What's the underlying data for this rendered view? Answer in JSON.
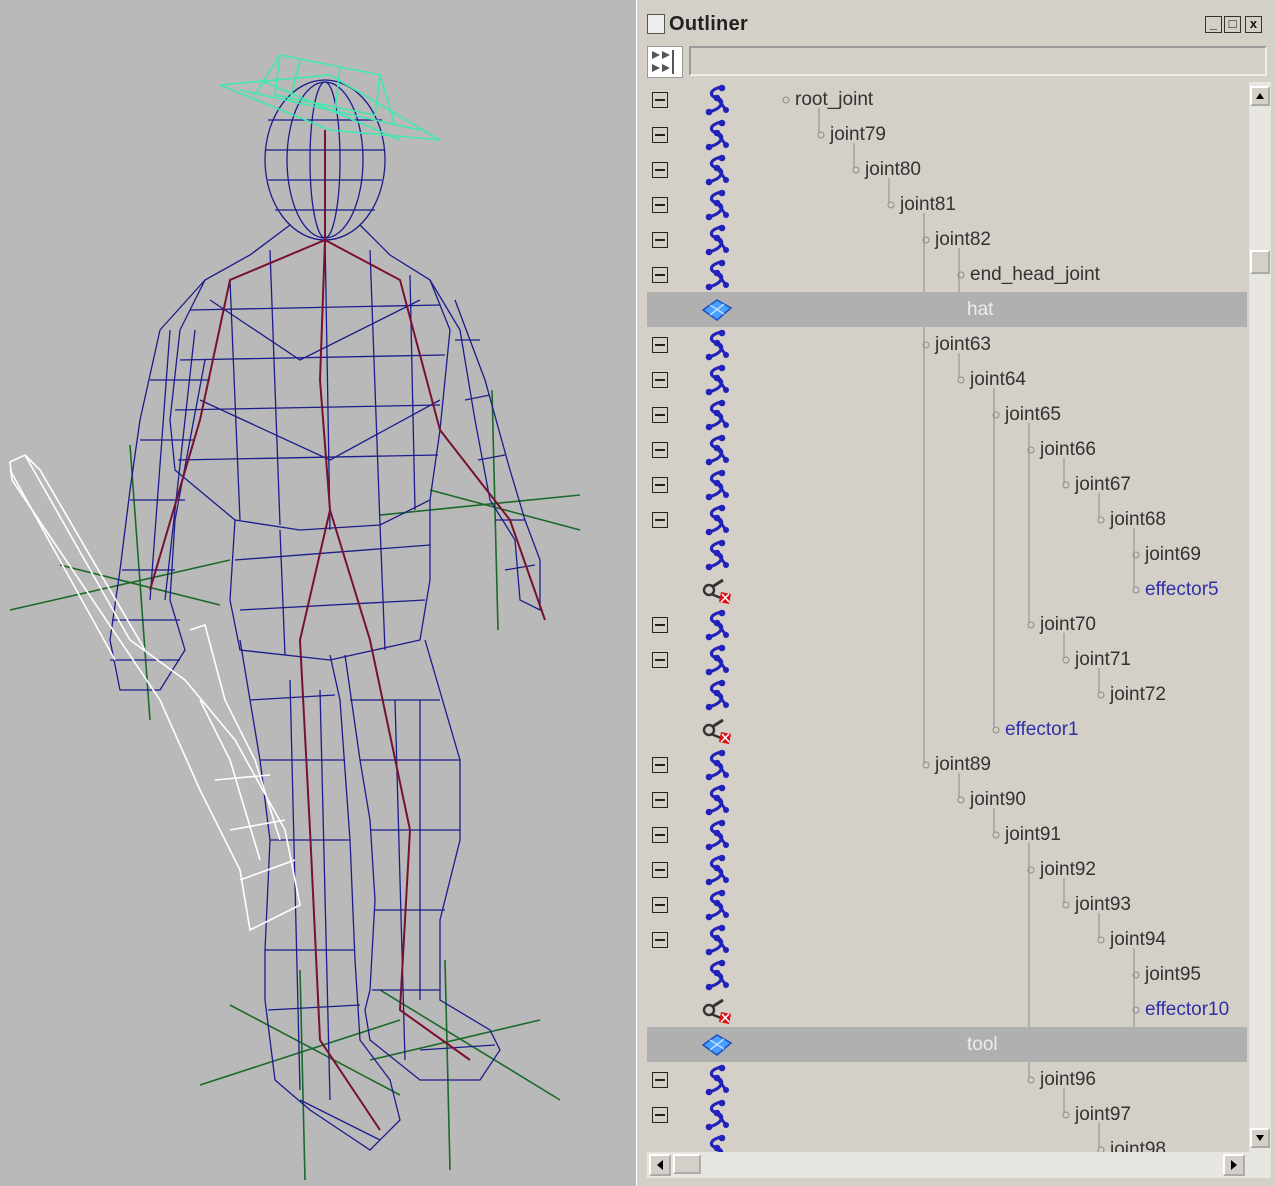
{
  "outliner": {
    "title": "Outliner",
    "minimize": "_",
    "maximize": "□",
    "close": "x",
    "filter_value": "",
    "rows": [
      {
        "label": "root_joint",
        "type": "joint",
        "depth": 0,
        "expander": true
      },
      {
        "label": "joint79",
        "type": "joint",
        "depth": 1,
        "expander": true
      },
      {
        "label": "joint80",
        "type": "joint",
        "depth": 2,
        "expander": true
      },
      {
        "label": "joint81",
        "type": "joint",
        "depth": 3,
        "expander": true
      },
      {
        "label": "joint82",
        "type": "joint",
        "depth": 4,
        "expander": true
      },
      {
        "label": "end_head_joint",
        "type": "joint",
        "depth": 5,
        "expander": true
      },
      {
        "label": "hat",
        "type": "mesh",
        "depth": 5,
        "expander": false,
        "selected": true
      },
      {
        "label": "joint63",
        "type": "joint",
        "depth": 4,
        "expander": true
      },
      {
        "label": "joint64",
        "type": "joint",
        "depth": 5,
        "expander": true
      },
      {
        "label": "joint65",
        "type": "joint",
        "depth": 6,
        "expander": true
      },
      {
        "label": "joint66",
        "type": "joint",
        "depth": 7,
        "expander": true
      },
      {
        "label": "joint67",
        "type": "joint",
        "depth": 8,
        "expander": true
      },
      {
        "label": "joint68",
        "type": "joint",
        "depth": 9,
        "expander": true
      },
      {
        "label": "joint69",
        "type": "joint",
        "depth": 10,
        "expander": false
      },
      {
        "label": "effector5",
        "type": "effector",
        "depth": 10,
        "expander": false
      },
      {
        "label": "joint70",
        "type": "joint",
        "depth": 7,
        "expander": true
      },
      {
        "label": "joint71",
        "type": "joint",
        "depth": 8,
        "expander": true
      },
      {
        "label": "joint72",
        "type": "joint",
        "depth": 9,
        "expander": false
      },
      {
        "label": "effector1",
        "type": "effector",
        "depth": 6,
        "expander": false
      },
      {
        "label": "joint89",
        "type": "joint",
        "depth": 4,
        "expander": true
      },
      {
        "label": "joint90",
        "type": "joint",
        "depth": 5,
        "expander": true
      },
      {
        "label": "joint91",
        "type": "joint",
        "depth": 6,
        "expander": true
      },
      {
        "label": "joint92",
        "type": "joint",
        "depth": 7,
        "expander": true
      },
      {
        "label": "joint93",
        "type": "joint",
        "depth": 8,
        "expander": true
      },
      {
        "label": "joint94",
        "type": "joint",
        "depth": 9,
        "expander": true
      },
      {
        "label": "joint95",
        "type": "joint",
        "depth": 10,
        "expander": false
      },
      {
        "label": "effector10",
        "type": "effector",
        "depth": 10,
        "expander": false
      },
      {
        "label": "tool",
        "type": "mesh",
        "depth": 10,
        "expander": false,
        "selected": true
      },
      {
        "label": "joint96",
        "type": "joint",
        "depth": 7,
        "expander": true
      },
      {
        "label": "joint97",
        "type": "joint",
        "depth": 8,
        "expander": true
      },
      {
        "label": "joint98",
        "type": "joint",
        "depth": 9,
        "expander": false
      }
    ]
  },
  "colors": {
    "viewport_bg": "#b9b9b9",
    "wireframe": "#1c1c8c",
    "skeleton": "#7a1030",
    "hat": "#40e8b0",
    "tool": "#ffffff",
    "locator": "#1a6a2a",
    "effector_text": "#2f2fa8"
  },
  "icons": {
    "joint": "joint-icon",
    "mesh": "mesh-icon",
    "effector": "effector-icon",
    "filter": "filter-icon"
  }
}
